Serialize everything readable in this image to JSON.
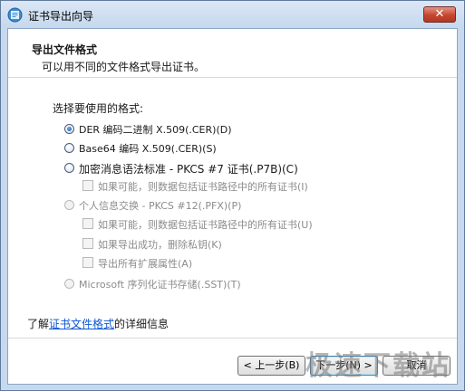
{
  "window": {
    "title": "证书导出向导",
    "close_label": "✕"
  },
  "header": {
    "title": "导出文件格式",
    "subtitle": "可以用不同的文件格式导出证书。"
  },
  "prompt": "选择要使用的格式:",
  "options": {
    "der": "DER 编码二进制 X.509(.CER)(D)",
    "base64": "Base64 编码 X.509(.CER)(S)",
    "pkcs7": "加密消息语法标准 - PKCS #7 证书(.P7B)(C)",
    "pkcs7_include_all": "如果可能，则数据包括证书路径中的所有证书(I)",
    "pfx": "个人信息交换 - PKCS #12(.PFX)(P)",
    "pfx_include_all": "如果可能，则数据包括证书路径中的所有证书(U)",
    "pfx_delete_key": "如果导出成功，删除私钥(K)",
    "pfx_export_ext": "导出所有扩展属性(A)",
    "sst": "Microsoft 序列化证书存储(.SST)(T)"
  },
  "learn_more": {
    "prefix": "了解",
    "link": "证书文件格式",
    "suffix": "的详细信息"
  },
  "buttons": {
    "back": "< 上一步(B)",
    "next": "下一步(N) >",
    "cancel": "取消"
  },
  "watermark": "极速下载站",
  "colors": {
    "accent": "#0b57d0",
    "close": "#c5462f"
  }
}
